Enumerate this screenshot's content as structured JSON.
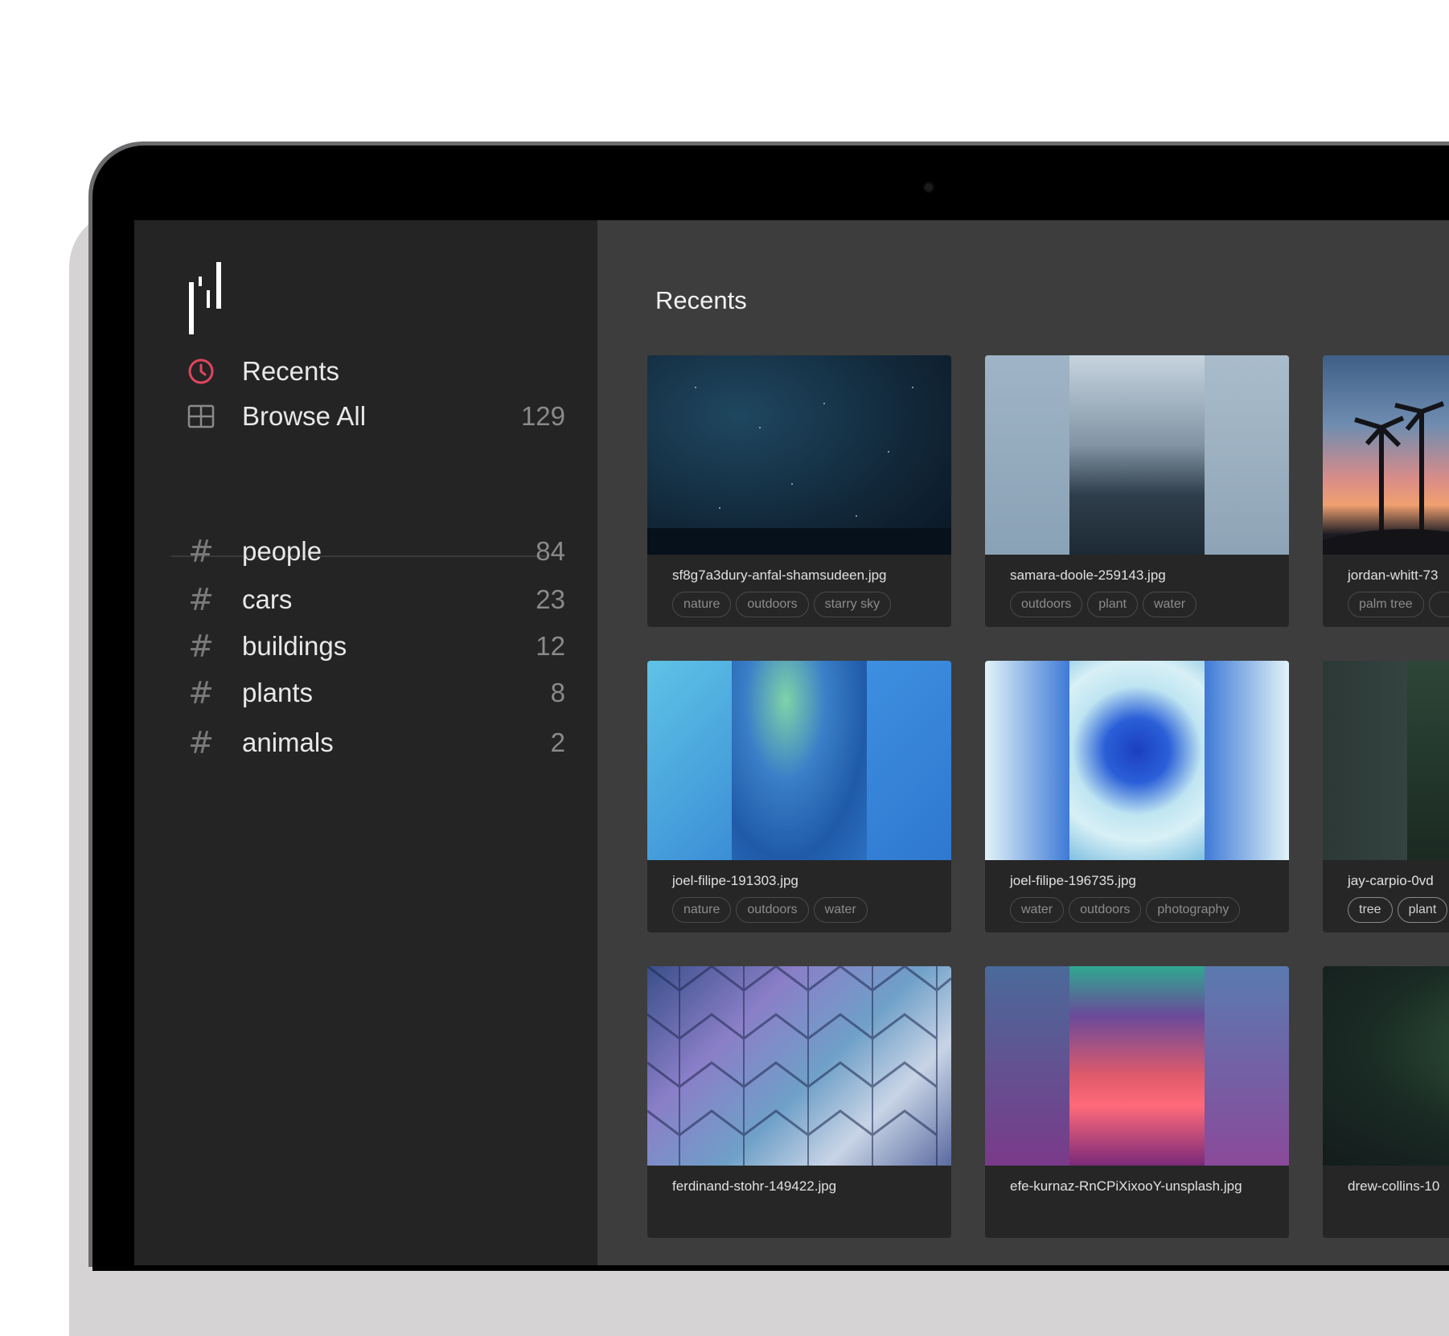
{
  "sidebar": {
    "nav": [
      {
        "label": "Recents",
        "icon": "clock-icon"
      },
      {
        "label": "Browse All",
        "count": "129",
        "icon": "grid-icon"
      }
    ],
    "tags": [
      {
        "label": "people",
        "count": "84"
      },
      {
        "label": "cars",
        "count": "23"
      },
      {
        "label": "buildings",
        "count": "12"
      },
      {
        "label": "plants",
        "count": "8"
      },
      {
        "label": "animals",
        "count": "2"
      }
    ],
    "hash_symbol": "#"
  },
  "main": {
    "title": "Recents",
    "cards": [
      {
        "filename": "sf8g7a3dury-anfal-shamsudeen.jpg",
        "tags": [
          "nature",
          "outdoors",
          "starry sky"
        ]
      },
      {
        "filename": "samara-doole-259143.jpg",
        "tags": [
          "outdoors",
          "plant",
          "water"
        ]
      },
      {
        "filename": "jordan-whitt-73",
        "tags": [
          "palm tree"
        ]
      },
      {
        "filename": "joel-filipe-191303.jpg",
        "tags": [
          "nature",
          "outdoors",
          "water"
        ]
      },
      {
        "filename": "joel-filipe-196735.jpg",
        "tags": [
          "water",
          "outdoors",
          "photography"
        ]
      },
      {
        "filename": "jay-carpio-0vd",
        "tags": [
          "tree",
          "plant"
        ]
      },
      {
        "filename": "ferdinand-stohr-149422.jpg",
        "tags": []
      },
      {
        "filename": "efe-kurnaz-RnCPiXixooY-unsplash.jpg",
        "tags": []
      },
      {
        "filename": "drew-collins-10",
        "tags": []
      }
    ]
  },
  "colors": {
    "accent": "#e0455e",
    "sidebar_bg": "#242424",
    "main_bg": "#3d3d3d",
    "card_bg": "#262626"
  }
}
